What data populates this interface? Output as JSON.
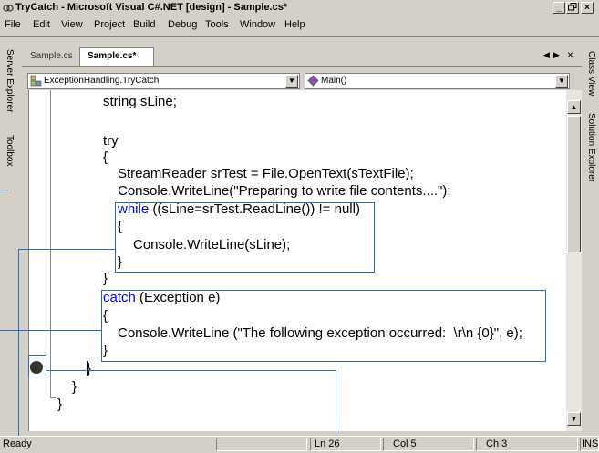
{
  "window": {
    "title": "TryCatch - Microsoft Visual C#.NET [design] - Sample.cs*",
    "minimize": "_",
    "restore": "×",
    "close": "×"
  },
  "menu": [
    "File",
    "Edit",
    "View",
    "Project",
    "Build",
    "Debug",
    "Tools",
    "Window",
    "Help"
  ],
  "left_tabs": [
    "Server Explorer",
    "Toolbox"
  ],
  "right_tabs": [
    "Class View",
    "Solution Explorer"
  ],
  "doc_tabs": {
    "inactive": "Sample.cs",
    "active": "Sample.cs*"
  },
  "nav": {
    "class_dropdown": "ExceptionHandling.TryCatch",
    "member_dropdown": "Main()"
  },
  "code_lines": {
    "l1": "string sLine;",
    "l2": "try",
    "l3": "{",
    "l4": "StreamReader srTest = File.OpenText(sTextFile);",
    "l5": "Console.WriteLine(\"Preparing to write file contents....\");",
    "l6_kw": "while",
    "l6_rest": " ((sLine=srTest.ReadLine()) != null)",
    "l7": "{",
    "l8": "Console.WriteLine(sLine);",
    "l9": "}",
    "l10": "}",
    "l11_kw": "catch",
    "l11_rest": " (Exception e)",
    "l12": "{",
    "l13": "Console.WriteLine (\"The following exception occurred:  \\r\\n {0}\", e);",
    "l14": "}",
    "l15": "}",
    "l16": "}",
    "l17": "}"
  },
  "status": {
    "ready": "Ready",
    "ln": "Ln 26",
    "col": "Col 5",
    "ch": "Ch 3",
    "ins": "INS"
  },
  "colors": {
    "callout": "#2a6fb3",
    "keyword": "#0000ff",
    "breakpoint": "#333333"
  }
}
